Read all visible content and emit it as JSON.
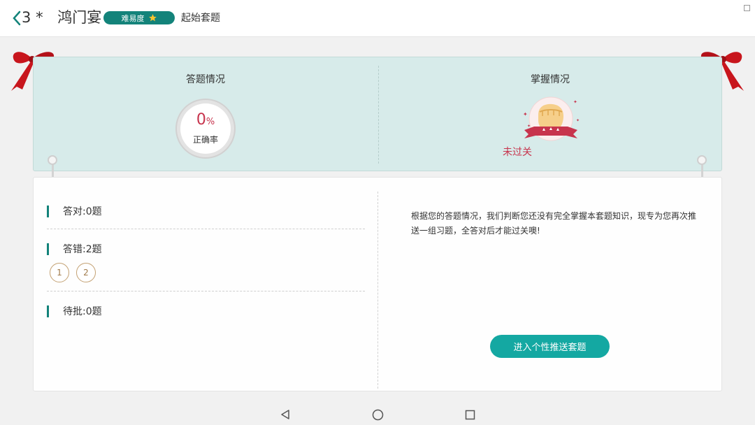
{
  "header": {
    "back_icon": "chevron-left-icon",
    "number": "3",
    "star": "*",
    "title": "鸿门宴",
    "difficulty_label": "难易度",
    "difficulty_icon": "star-icon",
    "set_label": "起始套题"
  },
  "summary": {
    "answer_title": "答题情况",
    "accuracy_value": "0",
    "accuracy_unit": "%",
    "accuracy_label": "正确率",
    "mastery_title": "掌握情况",
    "mastery_status": "未过关"
  },
  "stats": {
    "correct": "答对:0题",
    "wrong": "答错:2题",
    "wrong_questions": [
      "1",
      "2"
    ],
    "pending": "待批:0题"
  },
  "message": "根据您的答题情况，我们判断您还没有完全掌握本套题知识，现专为您再次推送一组习题，全答对后才能过关噢!",
  "action_button": "进入个性推送套题",
  "navbar": {
    "back": "triangle-back-icon",
    "home": "circle-home-icon",
    "recents": "square-recents-icon"
  },
  "colors": {
    "accent": "#13837a",
    "button": "#14a8a2",
    "alert": "#c7344d",
    "card": "#d7ebea"
  }
}
